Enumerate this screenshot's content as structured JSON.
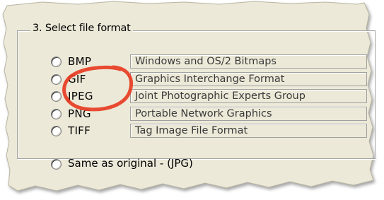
{
  "group": {
    "title": "3. Select file format"
  },
  "options": [
    {
      "code": "BMP",
      "desc": "Windows and OS/2 Bitmaps"
    },
    {
      "code": "GIF",
      "desc": "Graphics Interchange Format"
    },
    {
      "code": "JPEG",
      "desc": "Joint Photographic Experts Group"
    },
    {
      "code": "PNG",
      "desc": "Portable Network Graphics"
    },
    {
      "code": "TIFF",
      "desc": "Tag Image File Format"
    }
  ],
  "same_as_original": {
    "label": "Same as original  - (JPG)"
  },
  "colors": {
    "dialog_background": "#ece9d8",
    "highlight_circle": "#e8391f"
  }
}
